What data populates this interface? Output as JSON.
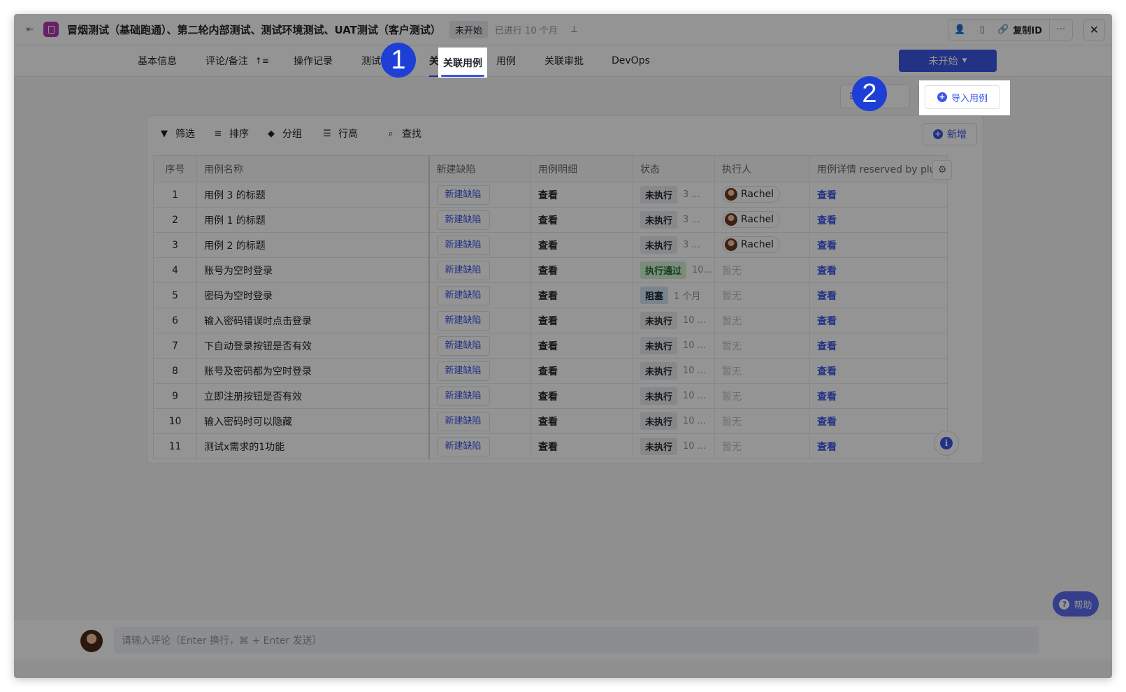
{
  "topbar": {
    "title": "冒烟测试（基础跑通）、第二轮内部测试、测试环境测试、UAT测试（客户测试）",
    "status_badge": "未开始",
    "elapsed": "已进行 10 个月",
    "copy_id_label": "复制ID"
  },
  "tabs": [
    {
      "label": "基本信息"
    },
    {
      "label": "评论/备注"
    },
    {
      "label": "操作记录"
    },
    {
      "label": "测试"
    },
    {
      "label": "关联用例"
    },
    {
      "label": "用例"
    },
    {
      "label": "关联审批"
    },
    {
      "label": "DevOps"
    }
  ],
  "status_button": "未开始",
  "actions": {
    "batch_label": "批",
    "import_label": "导入用例"
  },
  "toolbar": {
    "filter": "筛选",
    "sort": "排序",
    "group": "分组",
    "row_height": "行高",
    "find": "查找",
    "add": "新增"
  },
  "table": {
    "headers": [
      "序号",
      "用例名称",
      "新建缺陷",
      "用例明细",
      "状态",
      "执行人",
      "用例详情 reserved by plu"
    ],
    "bug_label": "新建缺陷",
    "detail_label": "查看",
    "view_label": "查看",
    "rows": [
      {
        "idx": "1",
        "name": "用例 3 的标题",
        "status": "未执行",
        "status_type": "default",
        "time": "3 ...",
        "executor": "Rachel"
      },
      {
        "idx": "2",
        "name": "用例 1 的标题",
        "status": "未执行",
        "status_type": "default",
        "time": "3 ...",
        "executor": "Rachel"
      },
      {
        "idx": "3",
        "name": "用例 2 的标题",
        "status": "未执行",
        "status_type": "default",
        "time": "3 ...",
        "executor": "Rachel"
      },
      {
        "idx": "4",
        "name": "账号为空时登录",
        "status": "执行通过",
        "status_type": "pass",
        "time": "10...",
        "executor": "暂无"
      },
      {
        "idx": "5",
        "name": "密码为空时登录",
        "status": "阻塞",
        "status_type": "block",
        "time": "1 个月",
        "executor": "暂无"
      },
      {
        "idx": "6",
        "name": "输入密码错误时点击登录",
        "status": "未执行",
        "status_type": "default",
        "time": "10 ...",
        "executor": "暂无"
      },
      {
        "idx": "7",
        "name": "下自动登录按钮是否有效",
        "status": "未执行",
        "status_type": "default",
        "time": "10 ...",
        "executor": "暂无"
      },
      {
        "idx": "8",
        "name": "账号及密码都为空时登录",
        "status": "未执行",
        "status_type": "default",
        "time": "10 ...",
        "executor": "暂无"
      },
      {
        "idx": "9",
        "name": "立即注册按钮是否有效",
        "status": "未执行",
        "status_type": "default",
        "time": "10 ...",
        "executor": "暂无"
      },
      {
        "idx": "10",
        "name": "输入密码时可以隐藏",
        "status": "未执行",
        "status_type": "default",
        "time": "10 ...",
        "executor": "暂无"
      },
      {
        "idx": "11",
        "name": "测试x需求的1功能",
        "status": "未执行",
        "status_type": "default",
        "time": "10 ...",
        "executor": "暂无"
      }
    ]
  },
  "help_label": "帮助",
  "comment": {
    "placeholder": "请输入评论（Enter 换行，⌘ + Enter 发送）"
  },
  "markers": {
    "m1": "1",
    "m2": "2"
  },
  "colors": {
    "accent": "#3c56e6",
    "marker": "#1e3fd6"
  }
}
